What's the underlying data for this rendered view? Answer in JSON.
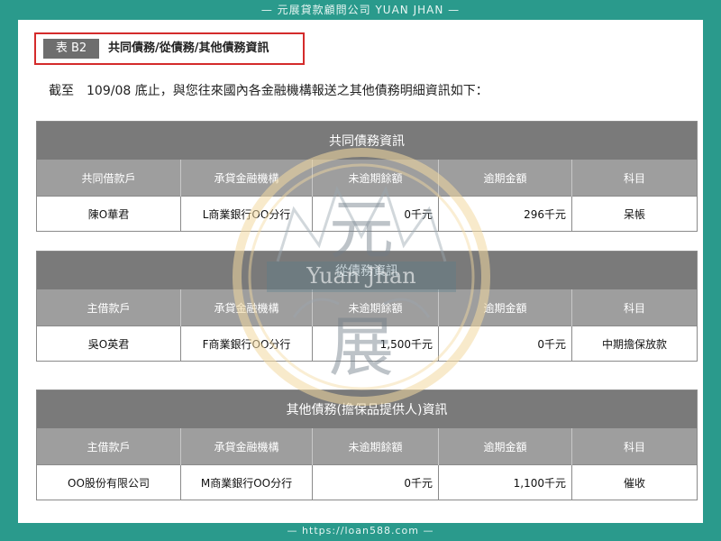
{
  "header_banner": "— 元展貸款顧問公司 YUAN JHAN —",
  "footer_banner": "— https://loan588.com —",
  "title": {
    "tag": "表 B2",
    "text": "共同債務/從債務/其他債務資訊"
  },
  "intro": "截至　109/08 底止，與您往來國內各金融機構報送之其他債務明細資訊如下：",
  "watermark": {
    "char_top": "元",
    "char_bottom": "展",
    "text": "Yuan Jhan"
  },
  "tables": [
    {
      "caption": "共同債務資訊",
      "headers": [
        "共同借款戶",
        "承貸金融機構",
        "未逾期餘額",
        "逾期金額",
        "科目"
      ],
      "row": [
        "陳O華君",
        "L商業銀行OO分行",
        "0千元",
        "296千元",
        "呆帳"
      ]
    },
    {
      "caption": "從債務資訊",
      "headers": [
        "主借款戶",
        "承貸金融機構",
        "未逾期餘額",
        "逾期金額",
        "科目"
      ],
      "row": [
        "吳O英君",
        "F商業銀行OO分行",
        "1,500千元",
        "0千元",
        "中期擔保放款"
      ]
    },
    {
      "caption": "其他債務(擔保品提供人)資訊",
      "headers": [
        "主借款戶",
        "承貸金融機構",
        "未逾期餘額",
        "逾期金額",
        "科目"
      ],
      "row": [
        "OO股份有限公司",
        "M商業銀行OO分行",
        "0千元",
        "1,100千元",
        "催收"
      ]
    }
  ]
}
